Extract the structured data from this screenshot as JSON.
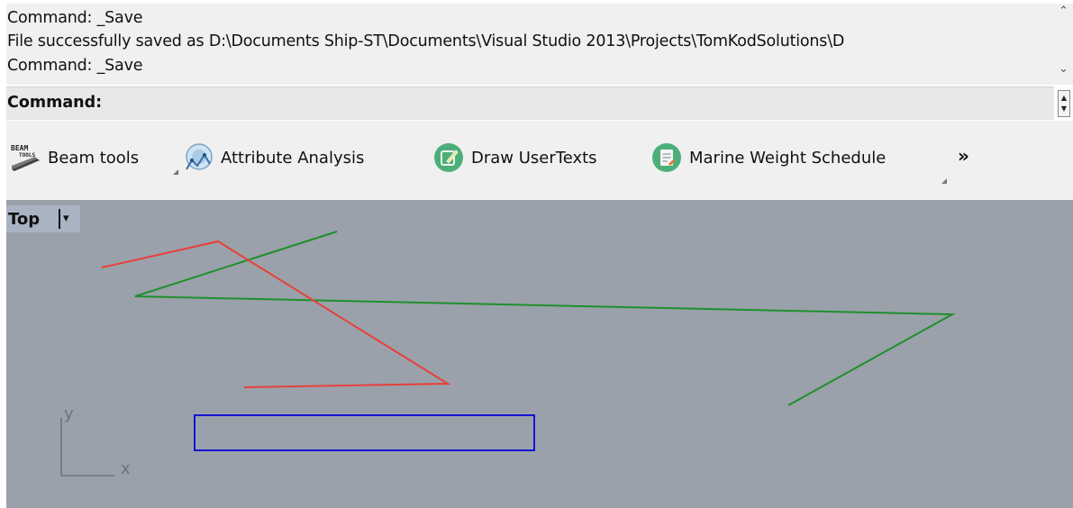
{
  "command_history": {
    "lines": [
      "Command: _Save",
      "File successfully saved as D:\\Documents Ship-ST\\Documents\\Visual Studio 2013\\Projects\\TomKodSolutions\\D",
      "Command: _Save"
    ]
  },
  "prompt": {
    "label": "Command:"
  },
  "toolbar": {
    "items": [
      {
        "label": "Beam tools",
        "icon": "beam-tools-icon"
      },
      {
        "label": "Attribute Analysis",
        "icon": "attribute-analysis-icon"
      },
      {
        "label": "Draw UserTexts",
        "icon": "draw-usertexts-icon"
      },
      {
        "label": "Marine Weight Schedule",
        "icon": "marine-weight-schedule-icon"
      }
    ],
    "overflow": "»",
    "beam_icon_text": {
      "top": "BEAM",
      "bottom": "TOOLS"
    }
  },
  "viewport": {
    "title": "Top",
    "dropdown_glyph": "▾",
    "background": "#9aa1aa",
    "axis": {
      "x_label": "x",
      "y_label": "y"
    },
    "curve_colors": {
      "red": "#e8403a",
      "green": "#1f8f2c",
      "blue": "#1414d6"
    }
  }
}
